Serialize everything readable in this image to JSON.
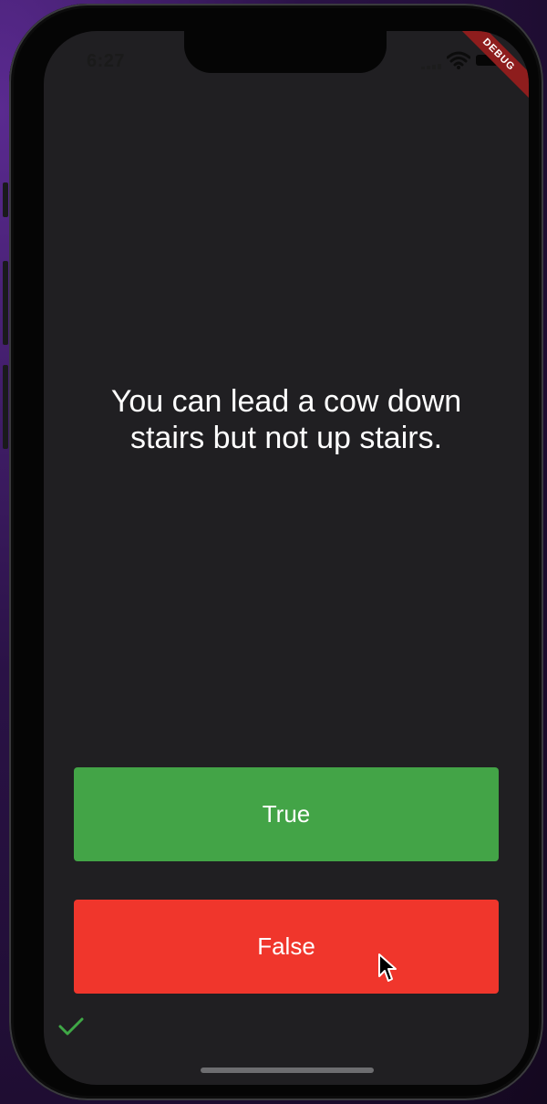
{
  "status_bar": {
    "time": "6:27",
    "icons": [
      "cellular-signal-icon",
      "wifi-icon",
      "battery-icon"
    ]
  },
  "debug_banner": "DEBUG",
  "quiz": {
    "question": "You can lead a cow down stairs but not up stairs.",
    "true_label": "True",
    "false_label": "False",
    "score_keeper": [
      "check-icon"
    ]
  },
  "colors": {
    "screen_background": "#201f22",
    "true_button": "#43a447",
    "false_button": "#f0362c",
    "check_icon": "#3fa846",
    "debug_banner": "#8e1d1d"
  }
}
